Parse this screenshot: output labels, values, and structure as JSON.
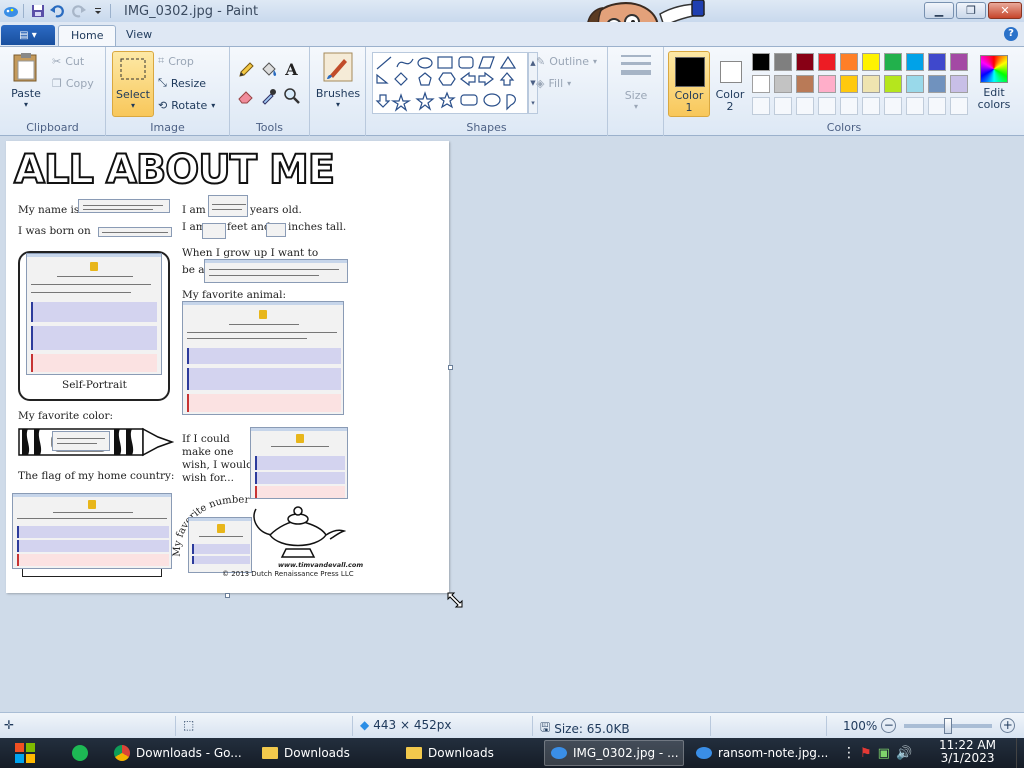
{
  "window": {
    "title": "IMG_0302.jpg - Paint"
  },
  "tabs": {
    "app_menu": "",
    "home": "Home",
    "view": "View"
  },
  "ribbon": {
    "clipboard": {
      "label": "Clipboard",
      "paste": "Paste",
      "cut": "Cut",
      "copy": "Copy"
    },
    "image": {
      "label": "Image",
      "select": "Select",
      "crop": "Crop",
      "resize": "Resize",
      "rotate": "Rotate"
    },
    "tools": {
      "label": "Tools"
    },
    "brushes": {
      "label": "Brushes"
    },
    "shapes": {
      "label": "Shapes",
      "outline": "Outline",
      "fill": "Fill"
    },
    "size": {
      "label": "Size"
    },
    "colors": {
      "label": "Colors",
      "color1": "Color\n1",
      "color1_line1": "Color",
      "color1_line2": "1",
      "color2_line1": "Color",
      "color2_line2": "2",
      "edit_line1": "Edit",
      "edit_line2": "colors",
      "color1_value": "#000000",
      "color2_value": "#ffffff",
      "palette_row1": [
        "#000000",
        "#7f7f7f",
        "#880015",
        "#ed1c24",
        "#ff7f27",
        "#fff200",
        "#22b14c",
        "#00a2e8",
        "#3f48cc",
        "#a349a4"
      ],
      "palette_row2": [
        "#ffffff",
        "#c3c3c3",
        "#b97a57",
        "#ffaec9",
        "#ffc90e",
        "#efe4b0",
        "#b5e61d",
        "#99d9ea",
        "#7092be",
        "#c8bfe7"
      ]
    }
  },
  "worksheet": {
    "title": "ALL ABOUT ME",
    "my_name_is": "My name is",
    "i_am": "I am",
    "years_old": "years old.",
    "i_was_born_on": "I was born on",
    "i_am2": "I am",
    "feet_and": "feet and",
    "inches_tall": "inches tall.",
    "when_i_grow_up": "When I grow up I want to",
    "be_a": "be a",
    "favorite_animal": "My favorite animal:",
    "self_portrait": "Self-Portrait",
    "favorite_color": "My favorite color:",
    "wish_line1": "If I could",
    "wish_line2": "make one",
    "wish_line3": "wish, I would",
    "wish_line4": "wish for...",
    "flag": "The flag of my home country:",
    "favorite_number": "My favorite number:",
    "url": "www.timvandevall.com",
    "copyright": "© 2013 Dutch Renaissance Press LLC"
  },
  "status": {
    "dimensions": "443 × 452px",
    "size": "Size: 65.0KB",
    "zoom": "100%"
  },
  "taskbar": {
    "items": [
      {
        "label": "Downloads - Go..."
      },
      {
        "label": "Downloads"
      },
      {
        "label": "Downloads"
      },
      {
        "label": "IMG_0302.jpg - ..."
      },
      {
        "label": "ransom-note.jpg..."
      }
    ],
    "time": "11:22 AM",
    "date": "3/1/2023"
  }
}
